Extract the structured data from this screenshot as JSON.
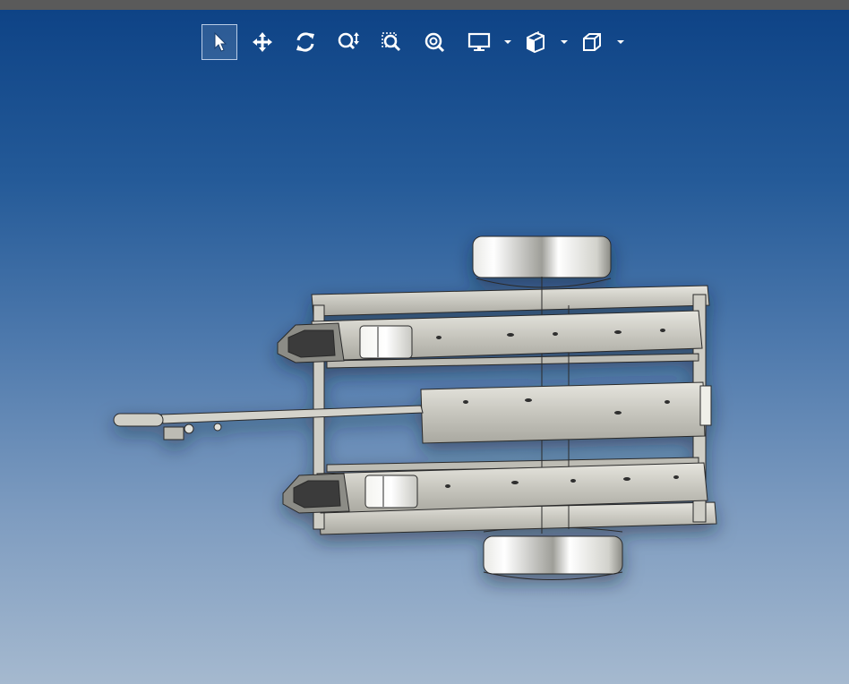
{
  "toolbar": {
    "tools": [
      {
        "name": "select",
        "icon": "cursor-arrow-icon",
        "active": true
      },
      {
        "name": "pan",
        "icon": "move-arrows-icon",
        "active": false
      },
      {
        "name": "rotate",
        "icon": "rotate-icon",
        "active": false
      },
      {
        "name": "zoom",
        "icon": "zoom-arrows-icon",
        "active": false
      },
      {
        "name": "zoom-window",
        "icon": "zoom-window-icon",
        "active": false
      },
      {
        "name": "zoom-fit",
        "icon": "zoom-fit-icon",
        "active": false
      },
      {
        "name": "display-mode",
        "icon": "monitor-icon",
        "dropdown": true
      },
      {
        "name": "section-view",
        "icon": "section-icon",
        "dropdown": true
      },
      {
        "name": "view-orientation",
        "icon": "cube-icon",
        "dropdown": true
      }
    ]
  },
  "colors": {
    "background_top": "#0e4386",
    "background_bottom": "#a5b9cf",
    "frame_strip": "#5a5a5a",
    "model_metal": "#c9c8c0",
    "icon": "#ffffff"
  },
  "viewport": {
    "model": "trailer-chassis-top-view"
  }
}
